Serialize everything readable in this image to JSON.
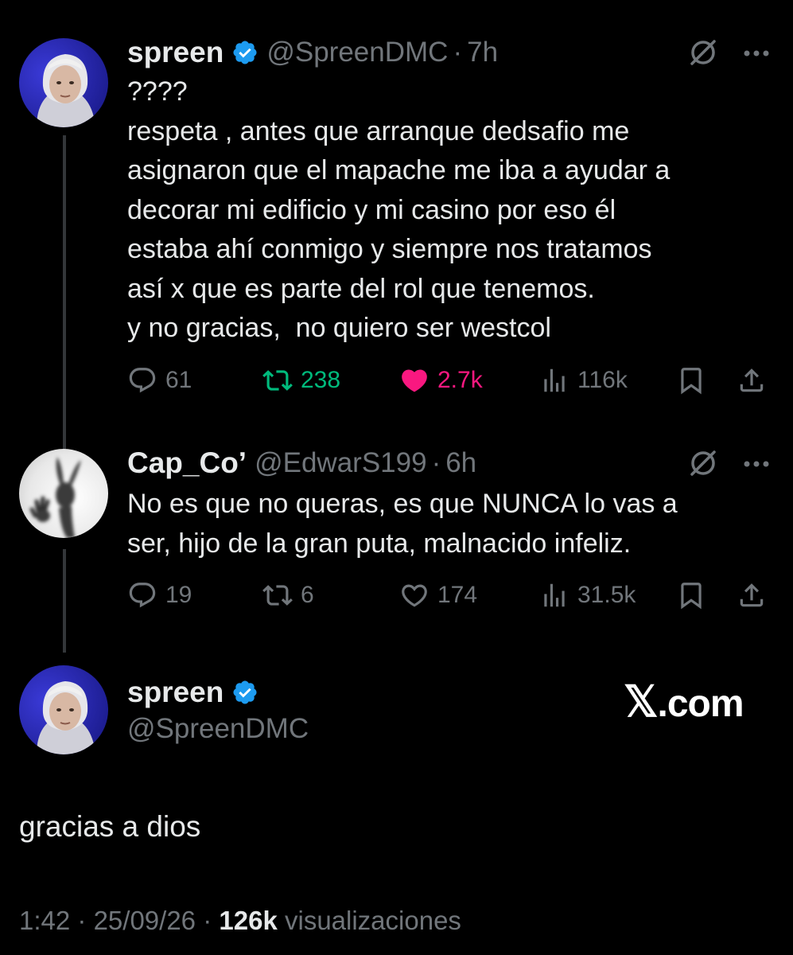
{
  "tweet1": {
    "name": "spreen",
    "handle": "@SpreenDMC",
    "time": "7h",
    "lines": [
      "????",
      "respeta , antes que arranque dedsafio me",
      "asignaron que el mapache me iba a ayudar a",
      "decorar mi edificio y mi casino por eso él",
      "estaba ahí conmigo y siempre nos tratamos",
      "así x que es parte del rol que tenemos.",
      "y no gracias,  no quiero ser westcol"
    ],
    "replies": "61",
    "reposts": "238",
    "likes": "2.7k",
    "views": "116k"
  },
  "tweet2": {
    "name": "Cap_Co’",
    "handle": "@EdwarS199",
    "time": "6h",
    "lines": [
      "No es que no queras, es que NUNCA lo vas a",
      "ser, hijo de la gran puta, malnacido infeliz."
    ],
    "replies": "19",
    "reposts": "6",
    "likes": "174",
    "views": "31.5k"
  },
  "main_tweet": {
    "name": "spreen",
    "handle": "@SpreenDMC",
    "text": "gracias a dios",
    "time": "1:42",
    "date": "25/09/26",
    "views": "126k",
    "views_label": "visualizaciones"
  },
  "watermark": {
    "logo": "𝕏",
    "text": ".com"
  },
  "separator": "·",
  "colors": {
    "background": "#000000",
    "text": "#e7e9ea",
    "secondary": "#71767b",
    "verified": "#1d9bf0",
    "repost_active": "#00ba7c",
    "like_active": "#f91880",
    "thread_line": "#333639"
  },
  "icons": [
    "verified-badge-icon",
    "grok-icon",
    "more-icon",
    "reply-icon",
    "repost-icon",
    "like-icon",
    "views-icon",
    "bookmark-icon",
    "share-icon"
  ]
}
